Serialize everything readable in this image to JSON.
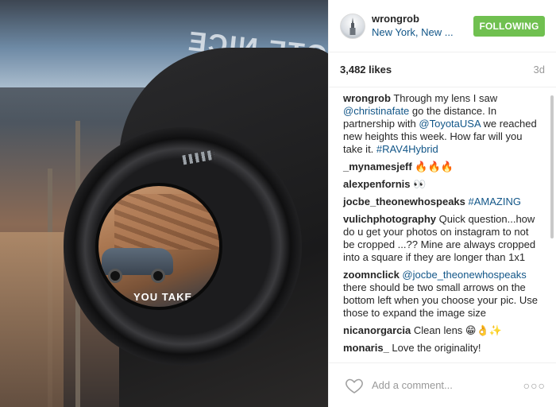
{
  "photo": {
    "billboard_text": "OTE NICE",
    "inner_text": "YOU TAKE"
  },
  "header": {
    "username": "wrongrob",
    "location": "New York, New ...",
    "follow_label": "FOLLOWING",
    "avatar_icon": "skyscraper-icon"
  },
  "stats": {
    "likes": "3,482 likes",
    "time": "3d"
  },
  "comments": [
    {
      "author": "wrongrob",
      "parts": [
        {
          "t": " Through my lens I saw "
        },
        {
          "t": "@christinafate",
          "link": true
        },
        {
          "t": " go the distance. In partnership with "
        },
        {
          "t": "@ToyotaUSA",
          "link": true
        },
        {
          "t": " we reached new heights this week. How far will you take it. "
        },
        {
          "t": "#RAV4Hybrid",
          "link": true
        }
      ]
    },
    {
      "author": "_mynamesjeff",
      "parts": [
        {
          "t": " 🔥🔥🔥"
        }
      ]
    },
    {
      "author": "alexpenfornis",
      "parts": [
        {
          "t": " 👀"
        }
      ]
    },
    {
      "author": "jocbe_theonewhospeaks",
      "parts": [
        {
          "t": " "
        },
        {
          "t": "#AMAZING",
          "link": true
        }
      ]
    },
    {
      "author": "vulichphotography",
      "parts": [
        {
          "t": " Quick question...how do u get your photos on instagram to not be cropped ...?? Mine are always cropped into a square if they are longer than 1x1"
        }
      ]
    },
    {
      "author": "zoomnclick",
      "parts": [
        {
          "t": " "
        },
        {
          "t": "@jocbe_theonewhospeaks",
          "link": true
        },
        {
          "t": " there should be two small arrows on the bottom left when you choose your pic. Use those to expand the image size"
        }
      ]
    },
    {
      "author": "nicanorgarcia",
      "parts": [
        {
          "t": " Clean lens 😁👌✨"
        }
      ]
    },
    {
      "author": "monaris_",
      "parts": [
        {
          "t": " Love the originality!"
        }
      ]
    }
  ],
  "footer": {
    "comment_placeholder": "Add a comment...",
    "more_label": "○○○",
    "like_icon": "heart-icon"
  },
  "colors": {
    "follow_button": "#70c050",
    "link": "#125688",
    "muted": "#999999"
  }
}
